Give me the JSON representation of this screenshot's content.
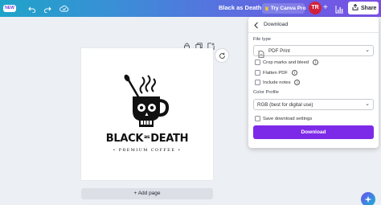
{
  "topbar": {
    "new_badge": "NEW",
    "undo_icon": "undo-icon",
    "redo_icon": "redo-icon",
    "cloud_icon": "cloud-saved-icon",
    "doc_title": "Black as Death",
    "try_pro_label": "Try Canva Pro",
    "avatar_initials": "TR",
    "share_label": "Share",
    "gradient_start": "#1fa4c9",
    "gradient_end": "#7a4fe6"
  },
  "canvas": {
    "design": {
      "brand_left": "BLACK",
      "brand_mid": "as",
      "brand_right": "DEATH",
      "tagline": "• PREMIUM COFFEE •"
    },
    "add_page_label": "+ Add page"
  },
  "download_panel": {
    "title": "Download",
    "file_type_label": "File type",
    "file_type_value": "PDF Print",
    "options": [
      {
        "label": "Crop marks and bleed",
        "checked": false,
        "has_info": true
      },
      {
        "label": "Flatten PDF",
        "checked": false,
        "has_info": true
      },
      {
        "label": "Include notes",
        "checked": false,
        "has_info": true
      }
    ],
    "color_profile_label": "Color Profile",
    "color_profile_value": "RGB (best for digital use)",
    "save_settings_label": "Save download settings",
    "save_settings_checked": false,
    "download_button": "Download",
    "accent_color": "#7d2ae8"
  }
}
